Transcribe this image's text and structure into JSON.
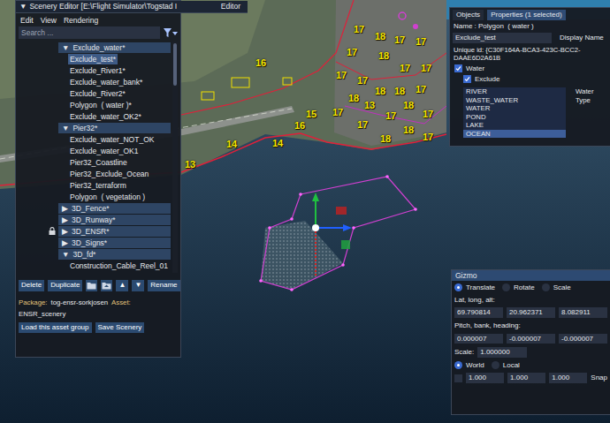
{
  "scene": {
    "labels": [
      {
        "text": "16"
      },
      {
        "text": "15"
      },
      {
        "text": "16"
      },
      {
        "text": "14"
      },
      {
        "text": "14"
      },
      {
        "text": "13"
      },
      {
        "text": "17"
      },
      {
        "text": "18"
      },
      {
        "text": "17"
      },
      {
        "text": "17"
      },
      {
        "text": "17"
      },
      {
        "text": "18"
      },
      {
        "text": "17"
      },
      {
        "text": "17"
      },
      {
        "text": "17"
      },
      {
        "text": "17"
      },
      {
        "text": "18"
      },
      {
        "text": "18"
      },
      {
        "text": "17"
      },
      {
        "text": "18"
      },
      {
        "text": "13"
      },
      {
        "text": "18"
      },
      {
        "text": "17"
      },
      {
        "text": "17"
      },
      {
        "text": "17"
      },
      {
        "text": "18"
      },
      {
        "text": "17"
      },
      {
        "text": "18"
      },
      {
        "text": "17"
      }
    ]
  },
  "scenery_editor": {
    "title_toggle": "▼",
    "title": "Scenery Editor [E:\\Flight Simulator\\Togstad I",
    "title_extra": "Editor",
    "menu": [
      "Edit",
      "View",
      "Rendering"
    ],
    "search": {
      "placeholder": "Search ..."
    },
    "tree": [
      {
        "kind": "group",
        "toggle": "▼",
        "label": "Exclude_water*",
        "selected": false,
        "locked": false
      },
      {
        "kind": "item",
        "label": "Exclude_test*",
        "selected": true,
        "locked": false
      },
      {
        "kind": "item",
        "label": "Exclude_River1*",
        "selected": false,
        "locked": false
      },
      {
        "kind": "item",
        "label": "Exclude_water_bank*",
        "selected": false,
        "locked": false
      },
      {
        "kind": "item",
        "label": "Exclude_River2*",
        "selected": false,
        "locked": false
      },
      {
        "kind": "item",
        "label": "Polygon  ( water )*",
        "selected": false,
        "locked": false
      },
      {
        "kind": "item",
        "label": "Exclude_water_OK2*",
        "selected": false,
        "locked": false
      },
      {
        "kind": "group",
        "toggle": "▼",
        "label": "Pier32*",
        "selected": false,
        "locked": false
      },
      {
        "kind": "item",
        "label": "Exclude_water_NOT_OK",
        "selected": false,
        "locked": false
      },
      {
        "kind": "item",
        "label": "Exclude_water_OK1",
        "selected": false,
        "locked": false
      },
      {
        "kind": "item",
        "label": "Pier32_Coastline",
        "selected": false,
        "locked": false
      },
      {
        "kind": "item",
        "label": "Pier32_Exclude_Ocean",
        "selected": false,
        "locked": false
      },
      {
        "kind": "item",
        "label": "Pier32_terraform",
        "selected": false,
        "locked": false
      },
      {
        "kind": "item",
        "label": "Polygon  ( vegetation )",
        "selected": false,
        "locked": false
      },
      {
        "kind": "group",
        "toggle": "▶",
        "label": "3D_Fence*",
        "selected": false,
        "locked": false
      },
      {
        "kind": "group",
        "toggle": "▶",
        "label": "3D_Runway*",
        "selected": false,
        "locked": false
      },
      {
        "kind": "group",
        "toggle": "▶",
        "label": "3D_ENSR*",
        "selected": false,
        "locked": true
      },
      {
        "kind": "group",
        "toggle": "▶",
        "label": "3D_Signs*",
        "selected": false,
        "locked": false
      },
      {
        "kind": "group",
        "toggle": "▼",
        "label": "3D_fd*",
        "selected": false,
        "locked": false
      },
      {
        "kind": "item",
        "label": "Construction_Cable_Reel_01",
        "selected": false,
        "locked": false
      }
    ],
    "buttons": [
      {
        "kind": "text",
        "label": "Delete"
      },
      {
        "kind": "text",
        "label": "Duplicate"
      },
      {
        "kind": "icon"
      },
      {
        "kind": "icon"
      },
      {
        "kind": "text",
        "label": "▲"
      },
      {
        "kind": "text",
        "label": "▼"
      },
      {
        "kind": "text",
        "label": "Rename"
      }
    ],
    "package_label": "Package:",
    "package": "tog-ensr-sorkjosen",
    "asset_label": "Asset:",
    "asset": "ENSR_scenery",
    "footer_buttons": [
      "Load this asset group",
      "Save Scenery"
    ]
  },
  "properties": {
    "tabs": [
      {
        "label": "Objects",
        "selected": false
      },
      {
        "label": "Properties (1 selected)",
        "selected": true
      }
    ],
    "name_line": "Name : Polygon  ( water )",
    "display_name": {
      "value": "Exclude_test",
      "label": "Display Name"
    },
    "unique_id": "Unique id: {C30F164A-BCA3-423C-BCC2-DAAE6D2A61B",
    "checks": [
      {
        "label": "Water",
        "checked": true
      },
      {
        "label": "Exclude",
        "checked": true
      }
    ],
    "water_types": [
      {
        "label": "RIVER",
        "selected": false
      },
      {
        "label": "WASTE_WATER",
        "selected": false
      },
      {
        "label": "WATER",
        "selected": false
      },
      {
        "label": "POND",
        "selected": false
      },
      {
        "label": "LAKE",
        "selected": false
      },
      {
        "label": "OCEAN",
        "selected": true
      }
    ],
    "water_type_label": "Water Type"
  },
  "gizmo": {
    "title": "Gizmo",
    "modes": [
      {
        "label": "Translate",
        "selected": true
      },
      {
        "label": "Rotate",
        "selected": false
      },
      {
        "label": "Scale",
        "selected": false
      }
    ],
    "position_label": "Lat, long, alt:",
    "position": [
      "69.790814",
      "20.962371",
      "8.082911"
    ],
    "rotation_label": "Pitch, bank, heading:",
    "rotation": [
      "0.000007",
      "-0.000007",
      "-0.000007"
    ],
    "scale_label": "Scale:",
    "scale": "1.000000",
    "spaces": [
      {
        "label": "World",
        "selected": true
      },
      {
        "label": "Local",
        "selected": false
      }
    ],
    "snap": {
      "checked": false,
      "values": [
        "1.000",
        "1.000",
        "1.000"
      ],
      "label": "Snap"
    }
  }
}
